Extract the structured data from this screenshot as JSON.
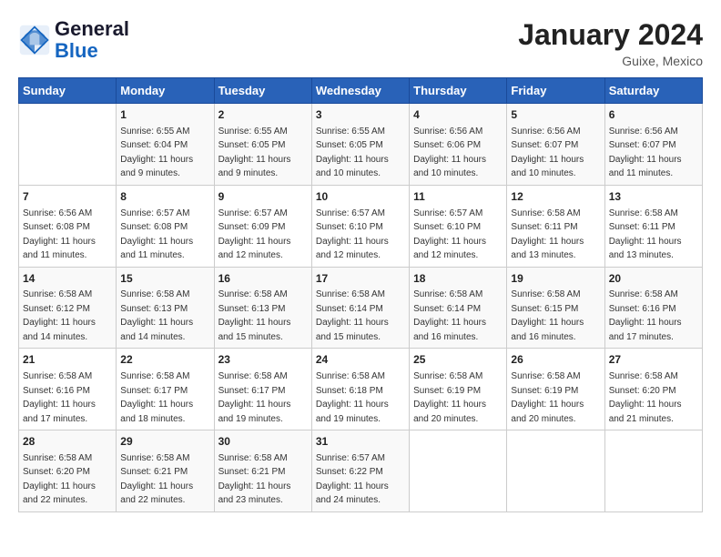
{
  "logo": {
    "line1": "General",
    "line2": "Blue"
  },
  "title": "January 2024",
  "location": "Guixe, Mexico",
  "header_days": [
    "Sunday",
    "Monday",
    "Tuesday",
    "Wednesday",
    "Thursday",
    "Friday",
    "Saturday"
  ],
  "weeks": [
    [
      {
        "day": "",
        "sunrise": "",
        "sunset": "",
        "daylight": ""
      },
      {
        "day": "1",
        "sunrise": "Sunrise: 6:55 AM",
        "sunset": "Sunset: 6:04 PM",
        "daylight": "Daylight: 11 hours and 9 minutes."
      },
      {
        "day": "2",
        "sunrise": "Sunrise: 6:55 AM",
        "sunset": "Sunset: 6:05 PM",
        "daylight": "Daylight: 11 hours and 9 minutes."
      },
      {
        "day": "3",
        "sunrise": "Sunrise: 6:55 AM",
        "sunset": "Sunset: 6:05 PM",
        "daylight": "Daylight: 11 hours and 10 minutes."
      },
      {
        "day": "4",
        "sunrise": "Sunrise: 6:56 AM",
        "sunset": "Sunset: 6:06 PM",
        "daylight": "Daylight: 11 hours and 10 minutes."
      },
      {
        "day": "5",
        "sunrise": "Sunrise: 6:56 AM",
        "sunset": "Sunset: 6:07 PM",
        "daylight": "Daylight: 11 hours and 10 minutes."
      },
      {
        "day": "6",
        "sunrise": "Sunrise: 6:56 AM",
        "sunset": "Sunset: 6:07 PM",
        "daylight": "Daylight: 11 hours and 11 minutes."
      }
    ],
    [
      {
        "day": "7",
        "sunrise": "Sunrise: 6:56 AM",
        "sunset": "Sunset: 6:08 PM",
        "daylight": "Daylight: 11 hours and 11 minutes."
      },
      {
        "day": "8",
        "sunrise": "Sunrise: 6:57 AM",
        "sunset": "Sunset: 6:08 PM",
        "daylight": "Daylight: 11 hours and 11 minutes."
      },
      {
        "day": "9",
        "sunrise": "Sunrise: 6:57 AM",
        "sunset": "Sunset: 6:09 PM",
        "daylight": "Daylight: 11 hours and 12 minutes."
      },
      {
        "day": "10",
        "sunrise": "Sunrise: 6:57 AM",
        "sunset": "Sunset: 6:10 PM",
        "daylight": "Daylight: 11 hours and 12 minutes."
      },
      {
        "day": "11",
        "sunrise": "Sunrise: 6:57 AM",
        "sunset": "Sunset: 6:10 PM",
        "daylight": "Daylight: 11 hours and 12 minutes."
      },
      {
        "day": "12",
        "sunrise": "Sunrise: 6:58 AM",
        "sunset": "Sunset: 6:11 PM",
        "daylight": "Daylight: 11 hours and 13 minutes."
      },
      {
        "day": "13",
        "sunrise": "Sunrise: 6:58 AM",
        "sunset": "Sunset: 6:11 PM",
        "daylight": "Daylight: 11 hours and 13 minutes."
      }
    ],
    [
      {
        "day": "14",
        "sunrise": "Sunrise: 6:58 AM",
        "sunset": "Sunset: 6:12 PM",
        "daylight": "Daylight: 11 hours and 14 minutes."
      },
      {
        "day": "15",
        "sunrise": "Sunrise: 6:58 AM",
        "sunset": "Sunset: 6:13 PM",
        "daylight": "Daylight: 11 hours and 14 minutes."
      },
      {
        "day": "16",
        "sunrise": "Sunrise: 6:58 AM",
        "sunset": "Sunset: 6:13 PM",
        "daylight": "Daylight: 11 hours and 15 minutes."
      },
      {
        "day": "17",
        "sunrise": "Sunrise: 6:58 AM",
        "sunset": "Sunset: 6:14 PM",
        "daylight": "Daylight: 11 hours and 15 minutes."
      },
      {
        "day": "18",
        "sunrise": "Sunrise: 6:58 AM",
        "sunset": "Sunset: 6:14 PM",
        "daylight": "Daylight: 11 hours and 16 minutes."
      },
      {
        "day": "19",
        "sunrise": "Sunrise: 6:58 AM",
        "sunset": "Sunset: 6:15 PM",
        "daylight": "Daylight: 11 hours and 16 minutes."
      },
      {
        "day": "20",
        "sunrise": "Sunrise: 6:58 AM",
        "sunset": "Sunset: 6:16 PM",
        "daylight": "Daylight: 11 hours and 17 minutes."
      }
    ],
    [
      {
        "day": "21",
        "sunrise": "Sunrise: 6:58 AM",
        "sunset": "Sunset: 6:16 PM",
        "daylight": "Daylight: 11 hours and 17 minutes."
      },
      {
        "day": "22",
        "sunrise": "Sunrise: 6:58 AM",
        "sunset": "Sunset: 6:17 PM",
        "daylight": "Daylight: 11 hours and 18 minutes."
      },
      {
        "day": "23",
        "sunrise": "Sunrise: 6:58 AM",
        "sunset": "Sunset: 6:17 PM",
        "daylight": "Daylight: 11 hours and 19 minutes."
      },
      {
        "day": "24",
        "sunrise": "Sunrise: 6:58 AM",
        "sunset": "Sunset: 6:18 PM",
        "daylight": "Daylight: 11 hours and 19 minutes."
      },
      {
        "day": "25",
        "sunrise": "Sunrise: 6:58 AM",
        "sunset": "Sunset: 6:19 PM",
        "daylight": "Daylight: 11 hours and 20 minutes."
      },
      {
        "day": "26",
        "sunrise": "Sunrise: 6:58 AM",
        "sunset": "Sunset: 6:19 PM",
        "daylight": "Daylight: 11 hours and 20 minutes."
      },
      {
        "day": "27",
        "sunrise": "Sunrise: 6:58 AM",
        "sunset": "Sunset: 6:20 PM",
        "daylight": "Daylight: 11 hours and 21 minutes."
      }
    ],
    [
      {
        "day": "28",
        "sunrise": "Sunrise: 6:58 AM",
        "sunset": "Sunset: 6:20 PM",
        "daylight": "Daylight: 11 hours and 22 minutes."
      },
      {
        "day": "29",
        "sunrise": "Sunrise: 6:58 AM",
        "sunset": "Sunset: 6:21 PM",
        "daylight": "Daylight: 11 hours and 22 minutes."
      },
      {
        "day": "30",
        "sunrise": "Sunrise: 6:58 AM",
        "sunset": "Sunset: 6:21 PM",
        "daylight": "Daylight: 11 hours and 23 minutes."
      },
      {
        "day": "31",
        "sunrise": "Sunrise: 6:57 AM",
        "sunset": "Sunset: 6:22 PM",
        "daylight": "Daylight: 11 hours and 24 minutes."
      },
      {
        "day": "",
        "sunrise": "",
        "sunset": "",
        "daylight": ""
      },
      {
        "day": "",
        "sunrise": "",
        "sunset": "",
        "daylight": ""
      },
      {
        "day": "",
        "sunrise": "",
        "sunset": "",
        "daylight": ""
      }
    ]
  ]
}
